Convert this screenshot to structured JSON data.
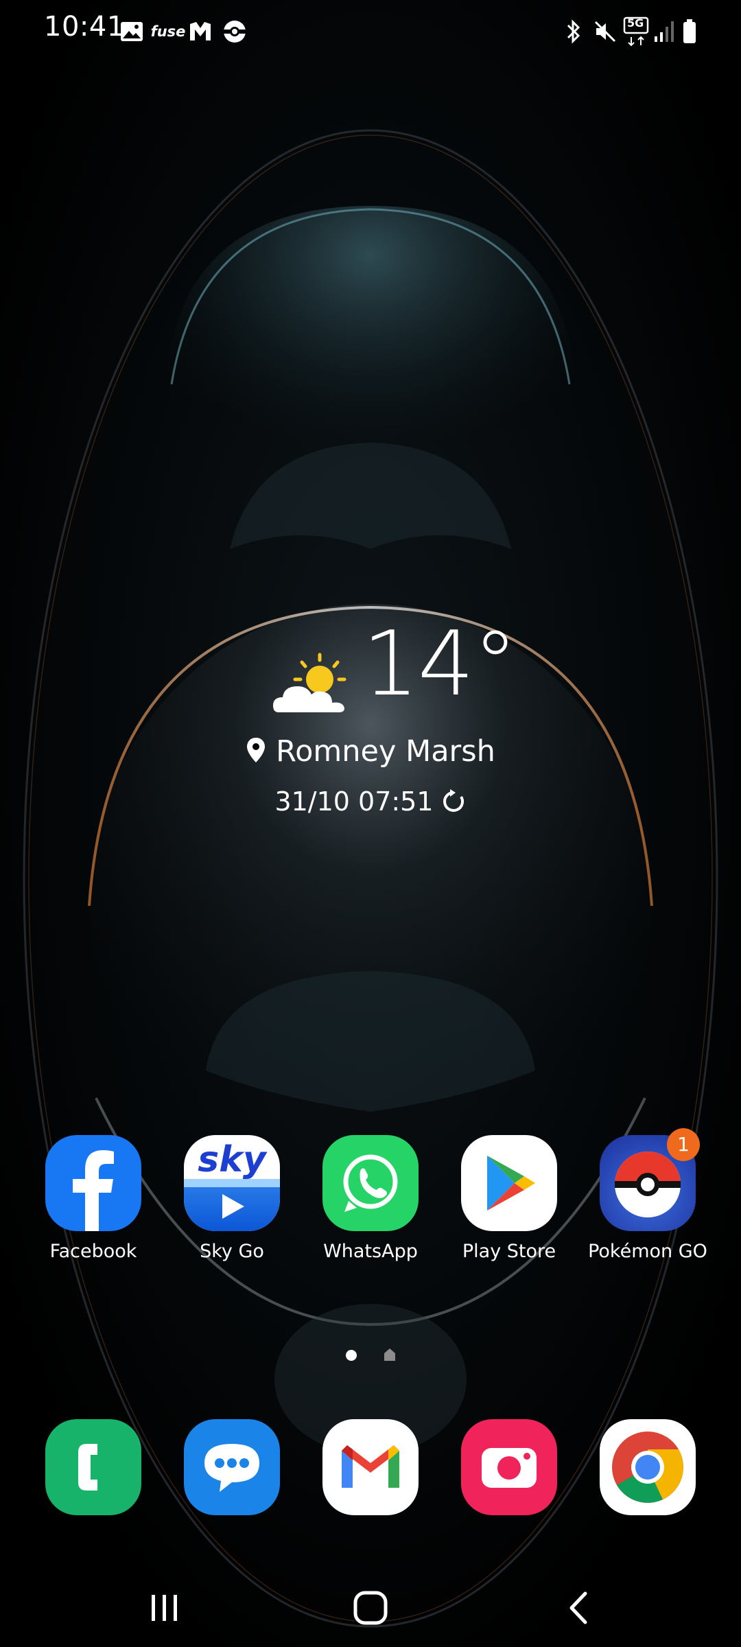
{
  "status_bar": {
    "time": "10:41",
    "left_icons": [
      "gallery-icon",
      "fuse-app-icon",
      "maps-m-icon",
      "pokeball-icon"
    ],
    "fuse_text": "fuse",
    "right_icons": [
      "bluetooth-icon",
      "mute-icon",
      "5g-icon",
      "signal-icon",
      "battery-icon"
    ],
    "network_label": "5G"
  },
  "weather": {
    "temperature": "14°",
    "condition_icon": "partly-sunny-icon",
    "location": "Romney Marsh",
    "updated": "31/10 07:51"
  },
  "apps": [
    {
      "label": "Facebook",
      "icon": "facebook-icon"
    },
    {
      "label": "Sky Go",
      "icon": "sky-go-icon",
      "brand_text": "sky"
    },
    {
      "label": "WhatsApp",
      "icon": "whatsapp-icon"
    },
    {
      "label": "Play Store",
      "icon": "play-store-icon"
    },
    {
      "label": "Pokémon GO",
      "icon": "pokemon-go-icon",
      "badge": "1"
    }
  ],
  "dock": [
    {
      "icon": "phone-icon"
    },
    {
      "icon": "messages-icon"
    },
    {
      "icon": "gmail-icon"
    },
    {
      "icon": "camera-icon"
    },
    {
      "icon": "chrome-icon"
    }
  ],
  "page_indicator": {
    "pages": 2,
    "current": 1
  },
  "navigation": [
    "recents-icon",
    "home-icon",
    "back-icon"
  ],
  "colors": {
    "facebook": "#1877f2",
    "whatsapp": "#25d366",
    "phone": "#17b36b",
    "messages": "#1a84e8",
    "camera": "#f0245a",
    "badge": "#f06a1d"
  }
}
